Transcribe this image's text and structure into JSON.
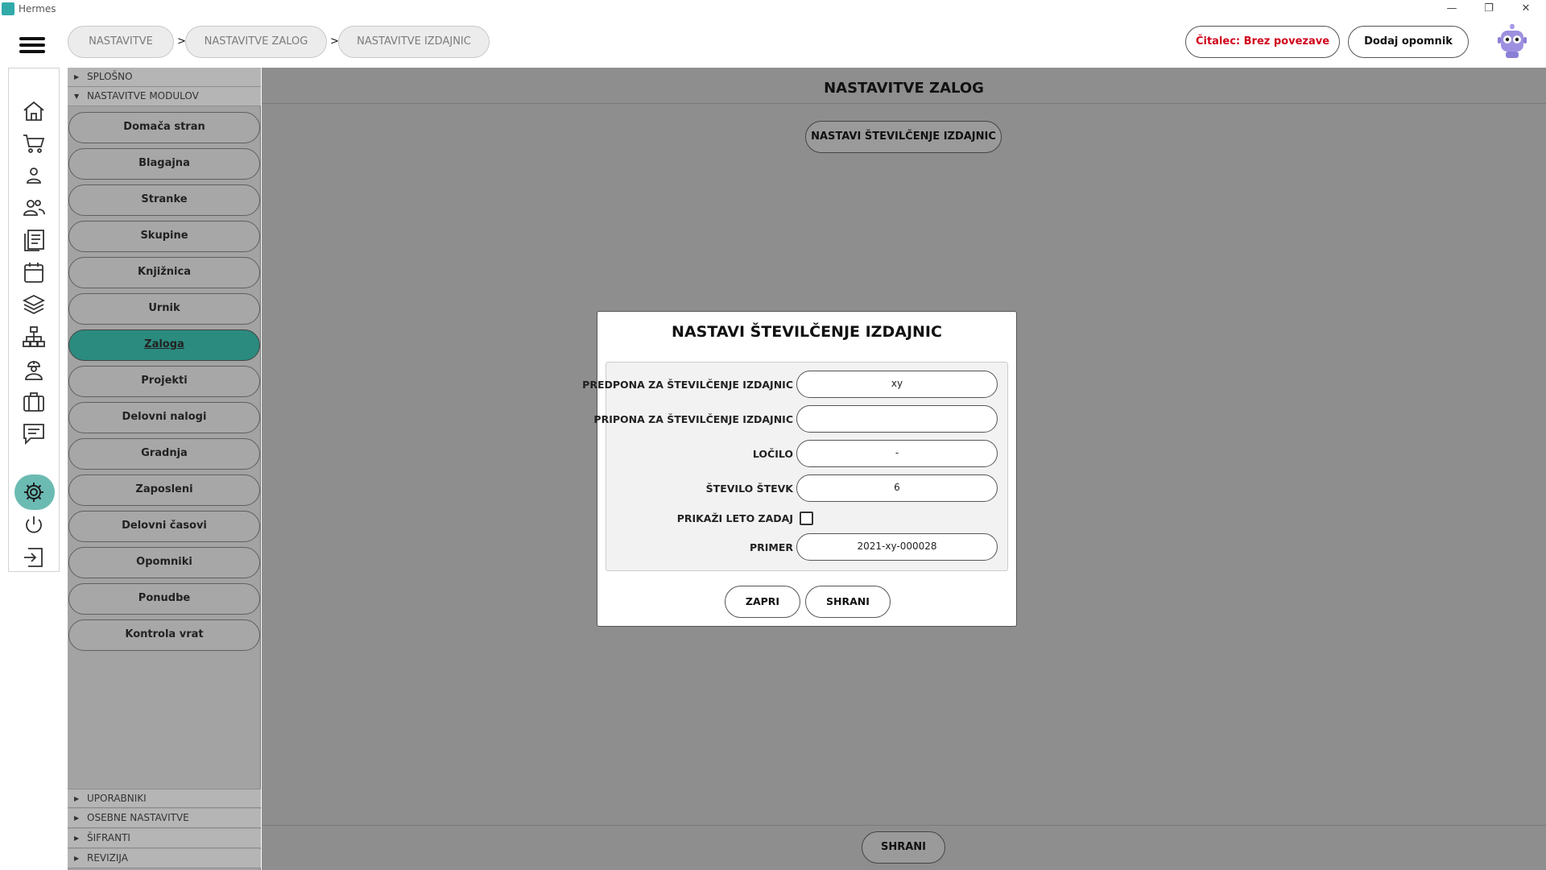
{
  "window": {
    "title": "Hermes",
    "controls": [
      "—",
      "❐",
      "✕"
    ]
  },
  "header": {
    "breadcrumbs": [
      "NASTAVITVE",
      "NASTAVITVE ZALOG",
      "NASTAVITVE IZDAJNIC"
    ],
    "separator": ">",
    "reader_status": "Čitalec: Brez povezave",
    "reader_status_color": "#d0021b",
    "add_reminder": "Dodaj opomnik"
  },
  "rail": {
    "icons": [
      "home-icon",
      "cart-icon",
      "person-icon",
      "people-icon",
      "documents-icon",
      "calendar-icon",
      "layers-icon",
      "hierarchy-icon",
      "worker-icon",
      "briefcase-icon",
      "chat-icon",
      "settings-icon",
      "power-icon",
      "logout-icon"
    ],
    "active": "settings-icon",
    "active_color": "#6bbbb3"
  },
  "sidebar": {
    "top_sections": [
      "SPLOŠNO",
      "NASTAVITVE MODULOV"
    ],
    "modules": [
      "Domača stran",
      "Blagajna",
      "Stranke",
      "Skupine",
      "Knjižnica",
      "Urnik",
      "Zaloga",
      "Projekti",
      "Delovni nalogi",
      "Gradnja",
      "Zaposleni",
      "Delovni časovi",
      "Opomniki",
      "Ponudbe",
      "Kontrola vrat"
    ],
    "active_module": "Zaloga",
    "active_color": "#2b8b7f",
    "bottom_sections": [
      "UPORABNIKI",
      "OSEBNE NASTAVITVE",
      "ŠIFRANTI",
      "REVIZIJA"
    ]
  },
  "main": {
    "title": "NASTAVITVE ZALOG",
    "numbering_button": "NASTAVI ŠTEVILČENJE IZDAJNIC",
    "save_button": "SHRANI"
  },
  "modal": {
    "title": "NASTAVI ŠTEVILČENJE IZDAJNIC",
    "fields": {
      "prefix": {
        "label": "PREDPONA ZA ŠTEVILČENJE IZDAJNIC",
        "value": "xy"
      },
      "suffix": {
        "label": "PRIPONA ZA ŠTEVILČENJE IZDAJNIC",
        "value": ""
      },
      "separator": {
        "label": "LOČILO",
        "value": "-"
      },
      "digits": {
        "label": "ŠTEVILO ŠTEVK",
        "value": "6"
      },
      "show_year_last": {
        "label": "PRIKAŽI LETO ZADAJ",
        "checked": false
      },
      "example": {
        "label": "PRIMER",
        "value": "2021-xy-000028"
      }
    },
    "close_button": "ZAPRI",
    "save_button": "SHRANI"
  }
}
